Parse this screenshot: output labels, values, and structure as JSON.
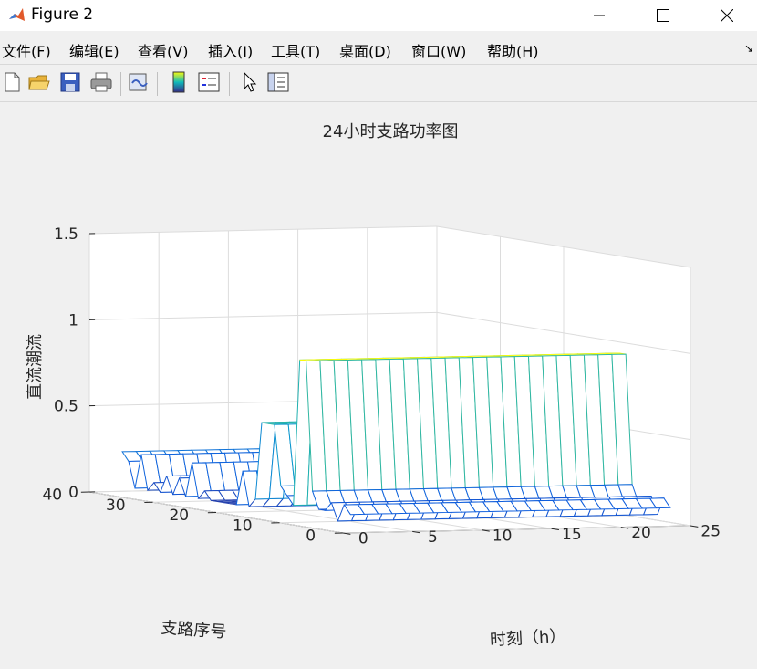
{
  "window": {
    "title": "Figure 2"
  },
  "menu": [
    "文件(F)",
    "编辑(E)",
    "查看(V)",
    "插入(I)",
    "工具(T)",
    "桌面(D)",
    "窗口(W)",
    "帮助(H)"
  ],
  "toolbar": [
    "new-figure",
    "open-file",
    "save",
    "print",
    "link-plot",
    "insert-colorbar",
    "insert-legend",
    "edit-plot-cursor",
    "property-inspector"
  ],
  "colors": {
    "low": "#352a87",
    "mid": "#0fbbbb",
    "high": "#f9fb0e"
  },
  "chart_data": {
    "type": "surface-3d-mesh",
    "title": "24小时支路功率图",
    "xlabel": "时刻（h）",
    "ylabel": "支路序号",
    "zlabel": "直流潮流",
    "xlim": [
      0,
      25
    ],
    "ylim": [
      0,
      40
    ],
    "zlim": [
      0,
      1.5
    ],
    "xticks": [
      "0",
      "5",
      "10",
      "15",
      "20",
      "25"
    ],
    "yticks": [
      "0",
      "10",
      "20",
      "30",
      "40"
    ],
    "zticks": [
      "0",
      "0.5",
      "1",
      "1.5"
    ],
    "x": [
      1,
      2,
      3,
      4,
      5,
      6,
      7,
      8,
      9,
      10,
      11,
      12,
      13,
      14,
      15,
      16,
      17,
      18,
      19,
      20,
      21,
      22,
      23,
      24
    ],
    "y": [
      1,
      2,
      3,
      4,
      5,
      6,
      7,
      8,
      9,
      10,
      11,
      12,
      13,
      14,
      15,
      16,
      17,
      18,
      19,
      20,
      21,
      22,
      23,
      24,
      25,
      26,
      27,
      28,
      29,
      30,
      31,
      32,
      33,
      34,
      35,
      36,
      37
    ],
    "z_by_branch": [
      0.1,
      0.15,
      0.05,
      0.15,
      0.1,
      0.1,
      0.2,
      0.95,
      0.95,
      0.1,
      0.15,
      0.2,
      0.55,
      0.55,
      0.55,
      0.1,
      0.05,
      0.25,
      0.05,
      0.05,
      0.05,
      0.05,
      0.05,
      0.1,
      0.05,
      0.25,
      0.05,
      0.15,
      0.05,
      0.15,
      0.05,
      0.1,
      0.05,
      0.25,
      0.05,
      0.2,
      0.25
    ],
    "grid": true,
    "view": "3d"
  }
}
